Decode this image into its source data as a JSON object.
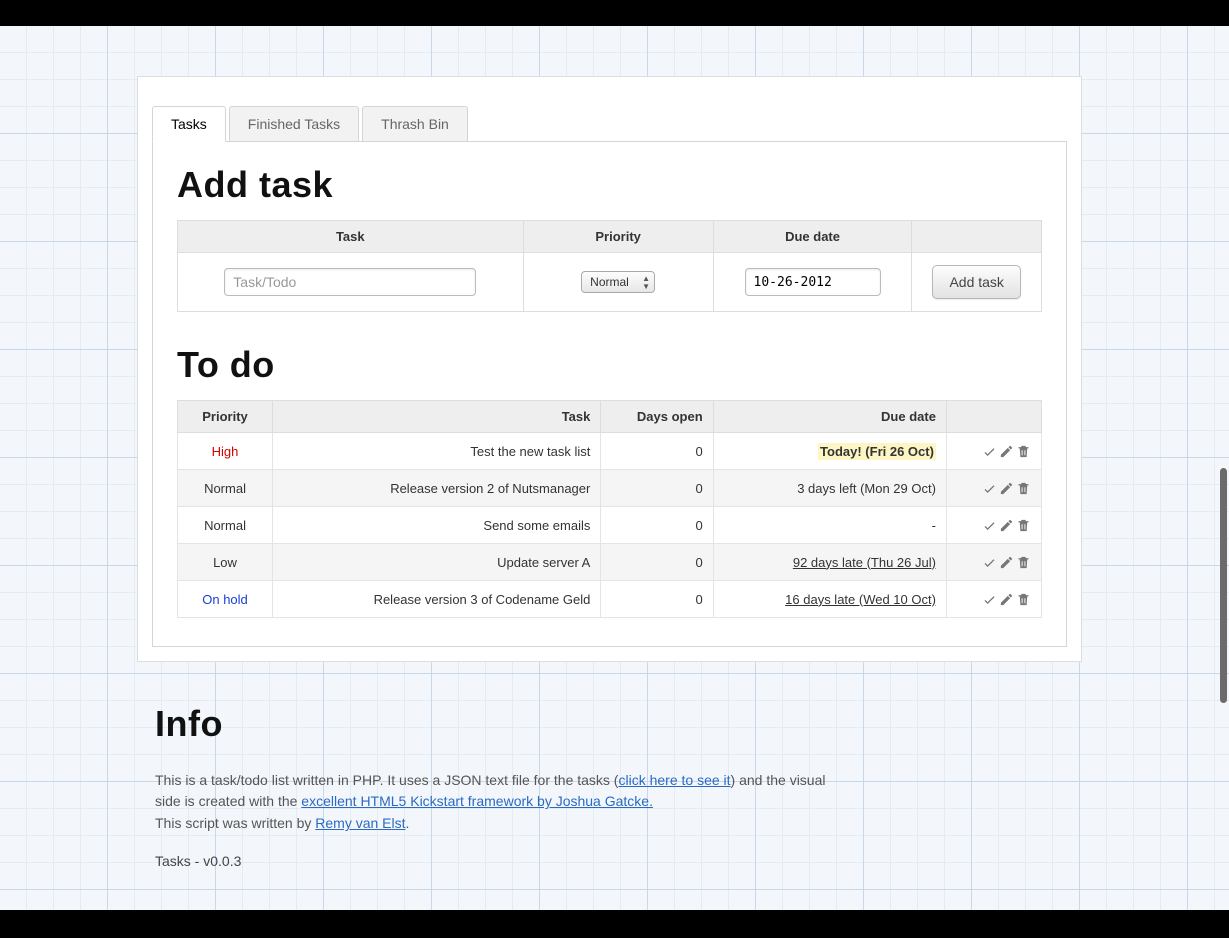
{
  "tabs": [
    {
      "label": "Tasks",
      "active": true
    },
    {
      "label": "Finished Tasks",
      "active": false
    },
    {
      "label": "Thrash Bin",
      "active": false
    }
  ],
  "add": {
    "heading": "Add task",
    "headers": {
      "task": "Task",
      "priority": "Priority",
      "due": "Due date"
    },
    "task_placeholder": "Task/Todo",
    "priority_value": "Normal",
    "date_value": "10-26-2012",
    "button_label": "Add task"
  },
  "todo": {
    "heading": "To do",
    "headers": {
      "priority": "Priority",
      "task": "Task",
      "days_open": "Days open",
      "due": "Due date"
    },
    "rows": [
      {
        "priority": "High",
        "priority_class": "prio-high",
        "task": "Test the new task list",
        "days_open": "0",
        "due": "Today! (Fri 26 Oct)",
        "due_class": "due-today"
      },
      {
        "priority": "Normal",
        "priority_class": "",
        "task": "Release version 2 of Nutsmanager",
        "days_open": "0",
        "due": "3 days left (Mon 29 Oct)",
        "due_class": ""
      },
      {
        "priority": "Normal",
        "priority_class": "",
        "task": "Send some emails",
        "days_open": "0",
        "due": "-",
        "due_class": ""
      },
      {
        "priority": "Low",
        "priority_class": "",
        "task": "Update server A",
        "days_open": "0",
        "due": "92 days late (Thu 26 Jul)",
        "due_class": "due-late"
      },
      {
        "priority": "On hold",
        "priority_class": "prio-onhold",
        "task": "Release version 3 of Codename Geld",
        "days_open": "0",
        "due": "16 days late (Wed 10 Oct)",
        "due_class": "due-late"
      }
    ]
  },
  "info": {
    "heading": "Info",
    "p1a": "This is a task/todo list written in PHP. It uses a JSON text file for the tasks (",
    "link1": "click here to see it",
    "p1b": ") and the visual side is created with the ",
    "link2": "excellent HTML5 Kickstart framework by Joshua Gatcke.",
    "p2a": "This script was written by ",
    "link3": "Remy van Elst",
    "p2b": ".",
    "version": "Tasks - v0.0.3"
  }
}
